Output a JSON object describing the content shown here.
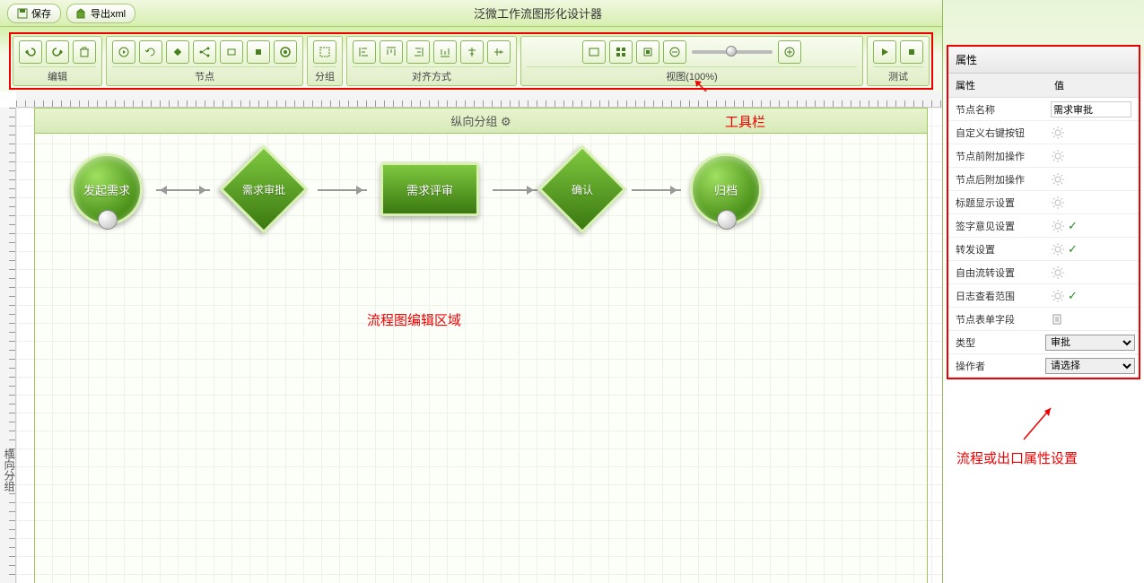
{
  "topbar": {
    "save": "保存",
    "export": "导出xml",
    "title": "泛微工作流图形化设计器"
  },
  "toolbar": {
    "groups": {
      "edit": "编辑",
      "node": "节点",
      "group": "分组",
      "align": "对齐方式",
      "view": "视图(100%)",
      "test": "测试"
    }
  },
  "canvas": {
    "group_v": "纵向分组",
    "group_h": "横向分组",
    "nodes": {
      "start": "发起需求",
      "approve": "需求审批",
      "review": "需求评审",
      "confirm": "确认",
      "archive": "归档"
    },
    "edit_area_label": "流程图编辑区域"
  },
  "annotations": {
    "toolbar": "工具栏",
    "props": "流程或出口属性设置"
  },
  "props": {
    "title": "属性",
    "col_prop": "属性",
    "col_val": "值",
    "rows": {
      "node_name": "节点名称",
      "node_name_val": "需求审批",
      "custom_menu": "自定义右键按钮",
      "pre_op": "节点前附加操作",
      "post_op": "节点后附加操作",
      "title_display": "标题显示设置",
      "sign_opinion": "签字意见设置",
      "forward": "转发设置",
      "free_flow": "自由流转设置",
      "log_scope": "日志查看范围",
      "form_field": "节点表单字段",
      "type": "类型",
      "type_val": "审批",
      "operator": "操作者",
      "operator_val": "请选择"
    }
  }
}
